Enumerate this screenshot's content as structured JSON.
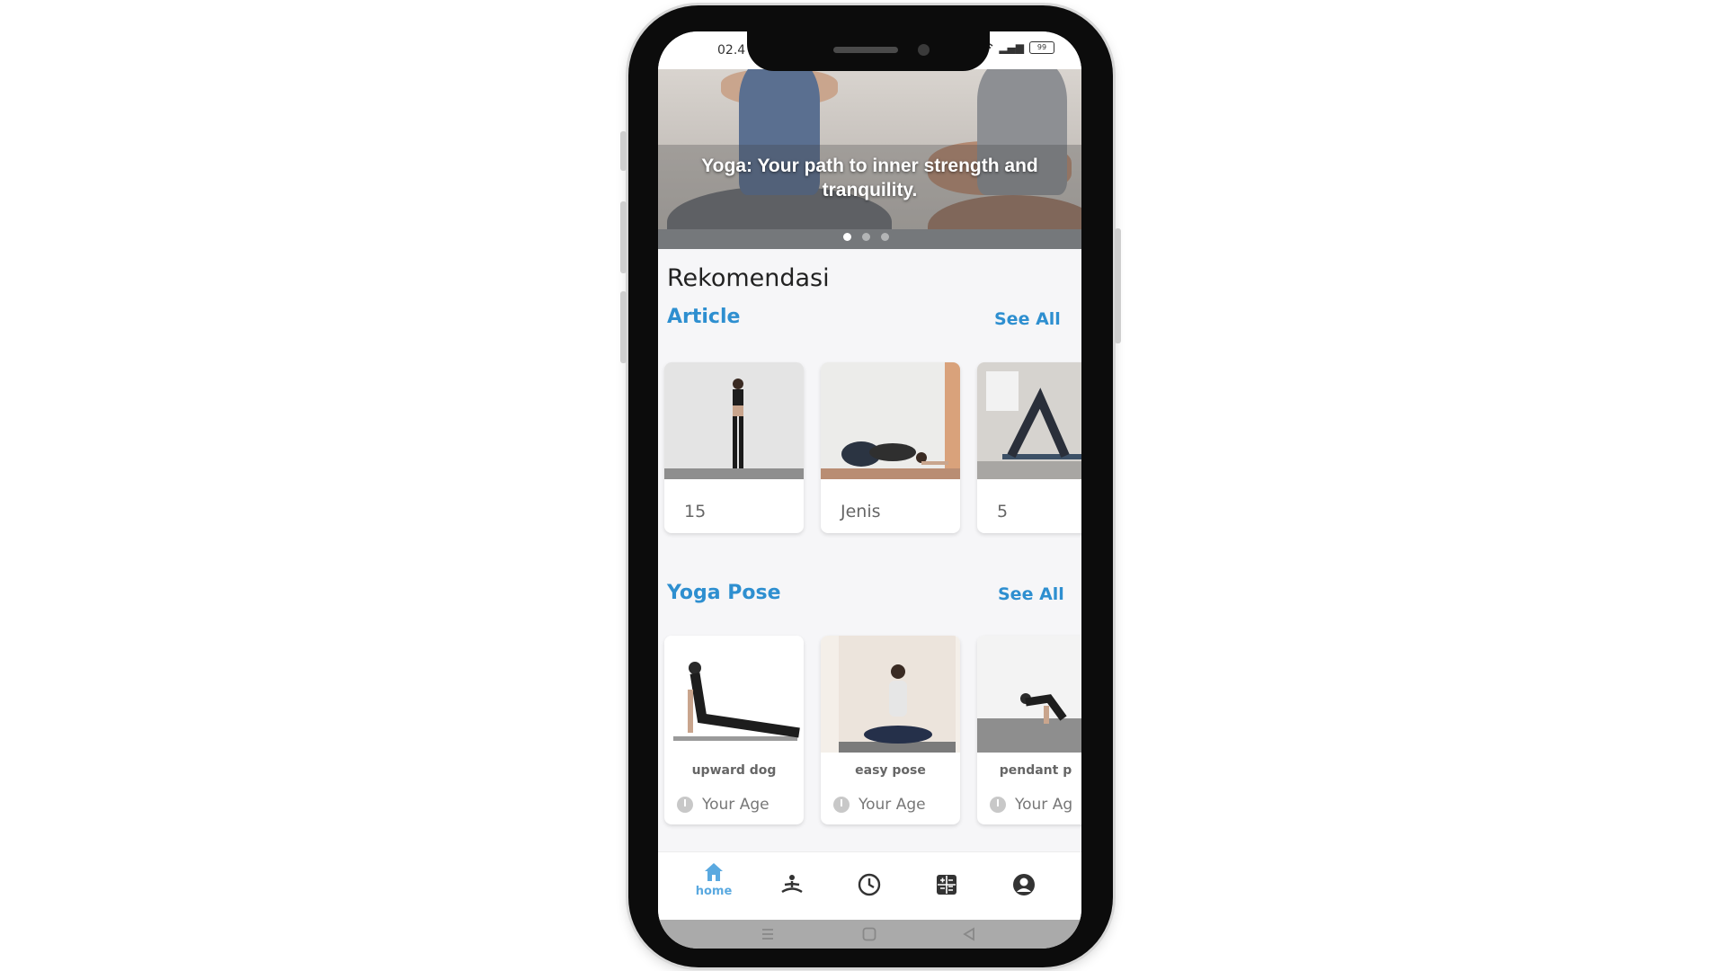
{
  "status_bar": {
    "time": "02.4",
    "signal": "▂▄▆",
    "battery": "99"
  },
  "hero": {
    "caption": "Yoga: Your path to inner strength and tranquility.",
    "dot_count": 3,
    "active_dot": 0
  },
  "recommendations": {
    "title": "Rekomendasi",
    "article": {
      "title": "Article",
      "see_all": "See All",
      "cards": [
        {
          "label": "15"
        },
        {
          "label": "Jenis"
        },
        {
          "label": "5"
        }
      ]
    },
    "yoga_pose": {
      "title": "Yoga Pose",
      "see_all": "See All",
      "cards": [
        {
          "name": "upward dog",
          "age": "Your Age"
        },
        {
          "name": "easy pose",
          "age": "Your Age"
        },
        {
          "name": "pendant p",
          "age": "Your Ag"
        }
      ]
    }
  },
  "bottom_nav": {
    "items": [
      {
        "icon": "home-icon",
        "label": "home",
        "active": true
      },
      {
        "icon": "meditation-icon",
        "label": "",
        "active": false
      },
      {
        "icon": "clock-icon",
        "label": "",
        "active": false
      },
      {
        "icon": "calculator-icon",
        "label": "",
        "active": false
      },
      {
        "icon": "profile-icon",
        "label": "",
        "active": false
      }
    ]
  },
  "colors": {
    "accent": "#2e8fd0",
    "nav_active": "#5aa9e0",
    "nav_inactive": "#333333"
  }
}
